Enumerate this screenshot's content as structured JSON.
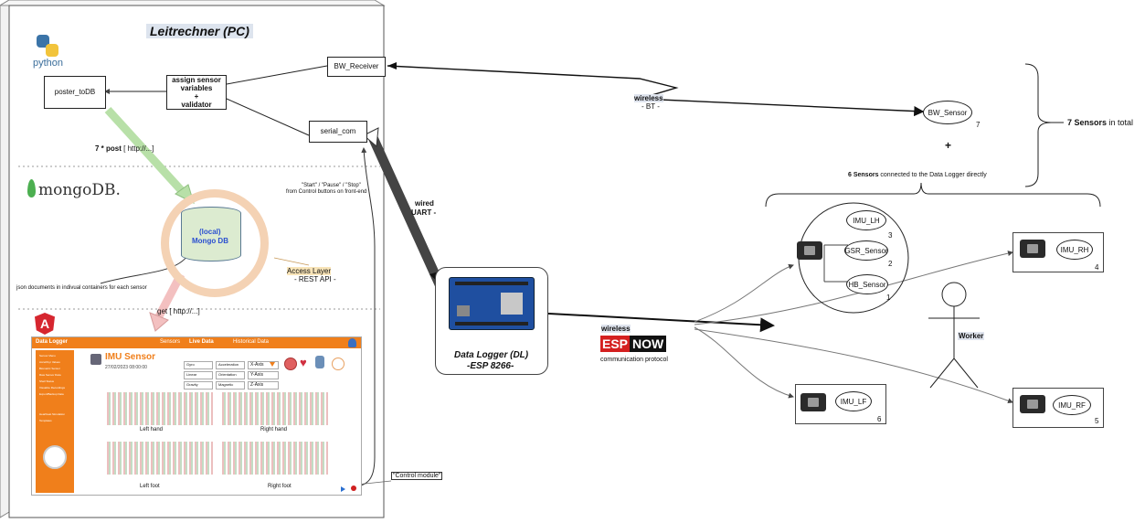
{
  "pc": {
    "title": "Leitrechner (PC)",
    "python_label": "python",
    "mongo_label": "mongoDB.",
    "nodes": {
      "poster": "poster_toDB",
      "assign": [
        "assign sensor",
        "variables",
        "+",
        "validator"
      ],
      "bw_receiver": "BW_Receiver",
      "serial_com": "serial_com"
    },
    "post_label": "7 * post",
    "post_url": " [ http://...]",
    "db": [
      "(local)",
      "Mongo DB"
    ],
    "json_note": "json documents in indivual containers for each sensor",
    "access_layer": "Access Layer",
    "rest_api": "- REST API -",
    "get_label": "get [ http://...]",
    "control_note": [
      "\"Start\" / \"Pause\" / \"Stop\"",
      "from Control buttons on front-end"
    ],
    "control_module": "\"Control module\""
  },
  "frontend": {
    "brand": "Data Logger",
    "nav": [
      "Sensors",
      "Live Data",
      "Historical Data"
    ],
    "sidebar": [
      "Sensor Menu",
      "Accel/Gyr Values",
      "Biometric Sensor",
      "Raw Sensor Data",
      "Shell Status",
      "Visualize Recordings",
      "Export/Backup Data",
      "Heartbeat Simulation",
      "Templates"
    ],
    "sensor_title": "IMU Sensor",
    "timestamp": "27/02/2023 08:00:00",
    "selectors": [
      "Gyro",
      "Linear",
      "Gravity",
      "Acceleration",
      "Orientation",
      "Magnetic",
      "X-Axis",
      "Y-Axis",
      "Z-Axis"
    ],
    "chart_titles": [
      "Left hand",
      "Right hand",
      "Left foot",
      "Right foot"
    ]
  },
  "link_labels": {
    "wireless_bt": [
      "wireless",
      "- BT -"
    ],
    "wired_uart": [
      "wired",
      "UART -"
    ],
    "wireless_esp": "wireless",
    "esp_now_a": "ESP",
    "esp_now_b": "NOW",
    "comm_protocol": "communication protocol"
  },
  "logger": [
    "Data Logger (DL)",
    "-ESP 8266-"
  ],
  "bw_sensor": {
    "label": "BW_Sensor",
    "num": "7"
  },
  "plus": "+",
  "total_bold": "7 Sensors",
  "total_rest": " in total",
  "direct_bold": "6 Sensors",
  "direct_rest": " connected to the Data Logger directly",
  "cluster": [
    {
      "label": "IMU_LH",
      "num": "3"
    },
    {
      "label": "GSR_Sensor",
      "num": "2"
    },
    {
      "label": "HB_Sensor",
      "num": "1"
    }
  ],
  "imu_rh": {
    "label": "IMU_RH",
    "num": "4"
  },
  "imu_lf": {
    "label": "IMU_LF",
    "num": "6"
  },
  "imu_rf": {
    "label": "IMU_RF",
    "num": "5"
  },
  "worker": "Worker"
}
